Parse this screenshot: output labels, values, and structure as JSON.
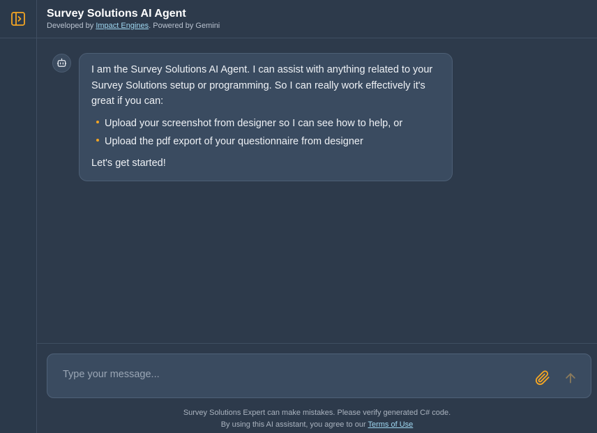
{
  "header": {
    "title": "Survey Solutions AI Agent",
    "subtitle_prefix": "Developed by ",
    "developer_link": "Impact Engines",
    "subtitle_suffix": ". Powered by Gemini"
  },
  "sidebar": {
    "toggle_icon": "sidebar-toggle-icon"
  },
  "chat": {
    "messages": [
      {
        "role": "assistant",
        "intro": "I am the Survey Solutions AI Agent. I can assist with anything related to your Survey Solutions setup or programming. So I can really work effectively it's great if you can:",
        "bullets": [
          "Upload your screenshot from designer so I can see how to help, or",
          "Upload the pdf export of your questionnaire from designer"
        ],
        "outro": "Let's get started!"
      }
    ]
  },
  "composer": {
    "placeholder": "Type your message...",
    "value": ""
  },
  "footer": {
    "line1": "Survey Solutions Expert can make mistakes. Please verify generated C# code.",
    "line2_prefix": "By using this AI assistant, you agree to our ",
    "terms_link": "Terms of Use"
  },
  "colors": {
    "accent": "#f5a623",
    "background": "#2d3a4b",
    "bubble": "#3a4b60",
    "link": "#9fd8f2"
  }
}
